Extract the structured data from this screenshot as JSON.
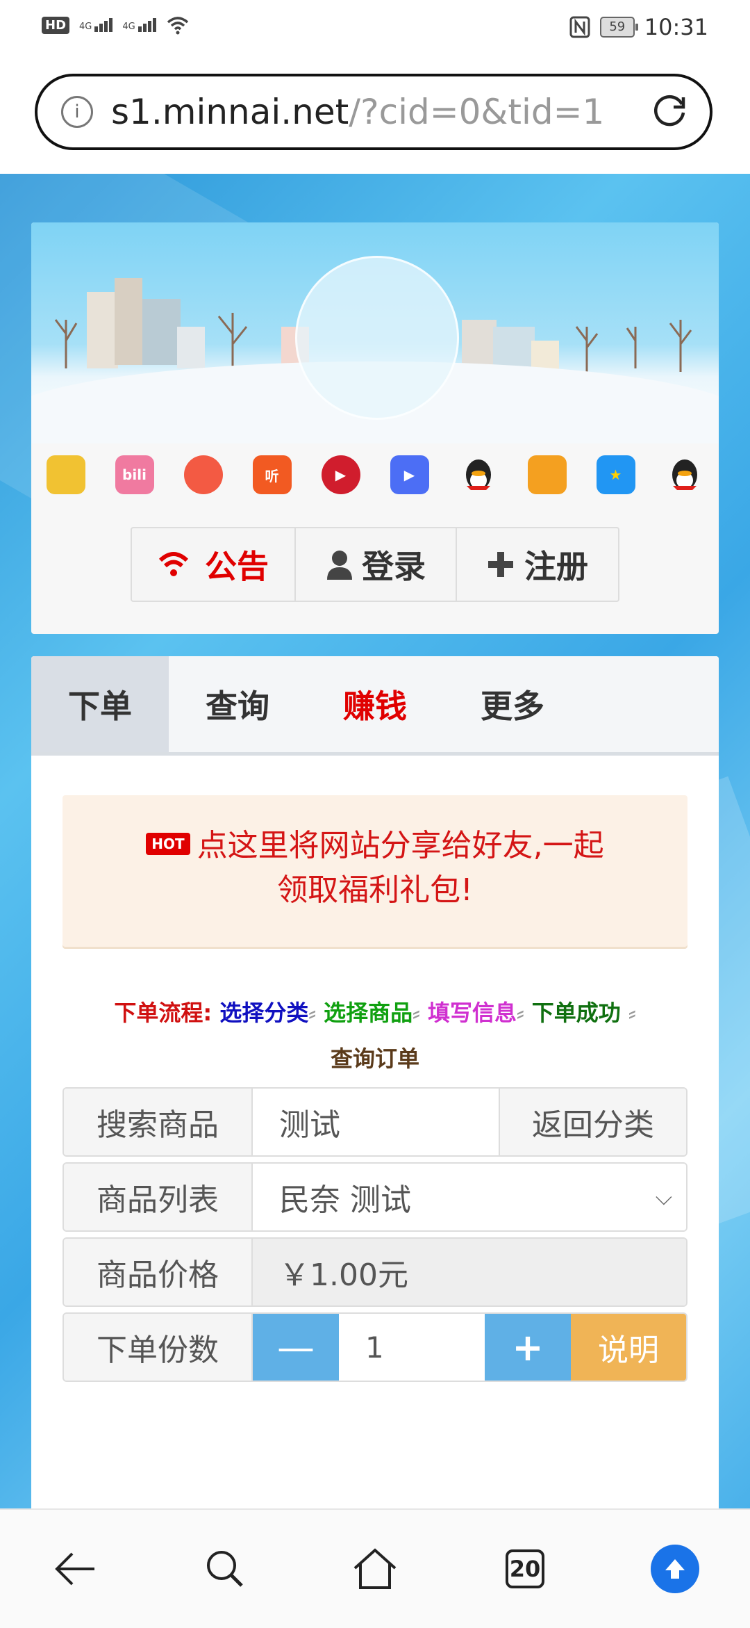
{
  "status_bar": {
    "hd": "HD",
    "sim1": "2",
    "net1": "4G",
    "net2": "4G",
    "battery": "59",
    "time": "10:31"
  },
  "browser": {
    "url_host": "s1.minnai.net",
    "url_path": "/?cid=0&tid=1",
    "tabs_count": "20"
  },
  "apps": [
    {
      "name": "app-icon-1",
      "label": "",
      "color": "#f1c232"
    },
    {
      "name": "app-icon-bilibili",
      "label": "bili",
      "color": "#f07aa0"
    },
    {
      "name": "app-icon-3",
      "label": "",
      "color": "#f35a43"
    },
    {
      "name": "app-icon-ting",
      "label": "听",
      "color": "#f25a22"
    },
    {
      "name": "app-icon-video",
      "label": "▶",
      "color": "#d01d2d"
    },
    {
      "name": "app-icon-6",
      "label": "▶",
      "color": "#4c6ef5"
    },
    {
      "name": "app-icon-qq",
      "label": "",
      "color": "#222222"
    },
    {
      "name": "app-icon-8",
      "label": "",
      "color": "#f4a020"
    },
    {
      "name": "app-icon-qzone",
      "label": "★",
      "color": "#2196f3"
    },
    {
      "name": "app-icon-qq2",
      "label": "",
      "color": "#222222"
    }
  ],
  "top_buttons": {
    "notice": "公告",
    "login": "登录",
    "register": "注册"
  },
  "tabs": [
    "下单",
    "查询",
    "赚钱",
    "更多"
  ],
  "share": {
    "hot": "HOT",
    "line1": "点这里将网站分享给好友,一起",
    "line2": "领取福利礼包!"
  },
  "flow": {
    "label": "下单流程:",
    "step1": "选择分类",
    "step2": "选择商品",
    "step3": "填写信息",
    "step4": "下单成功",
    "step5": "查询订单"
  },
  "form": {
    "search_label": "搜索商品",
    "search_value": "测试",
    "back_label": "返回分类",
    "list_label": "商品列表",
    "list_value": "民奈 测试",
    "price_label": "商品价格",
    "price_value": "￥1.00元",
    "qty_label": "下单份数",
    "qty_minus": "—",
    "qty_value": "1",
    "qty_plus": "+",
    "qty_help": "说明"
  }
}
